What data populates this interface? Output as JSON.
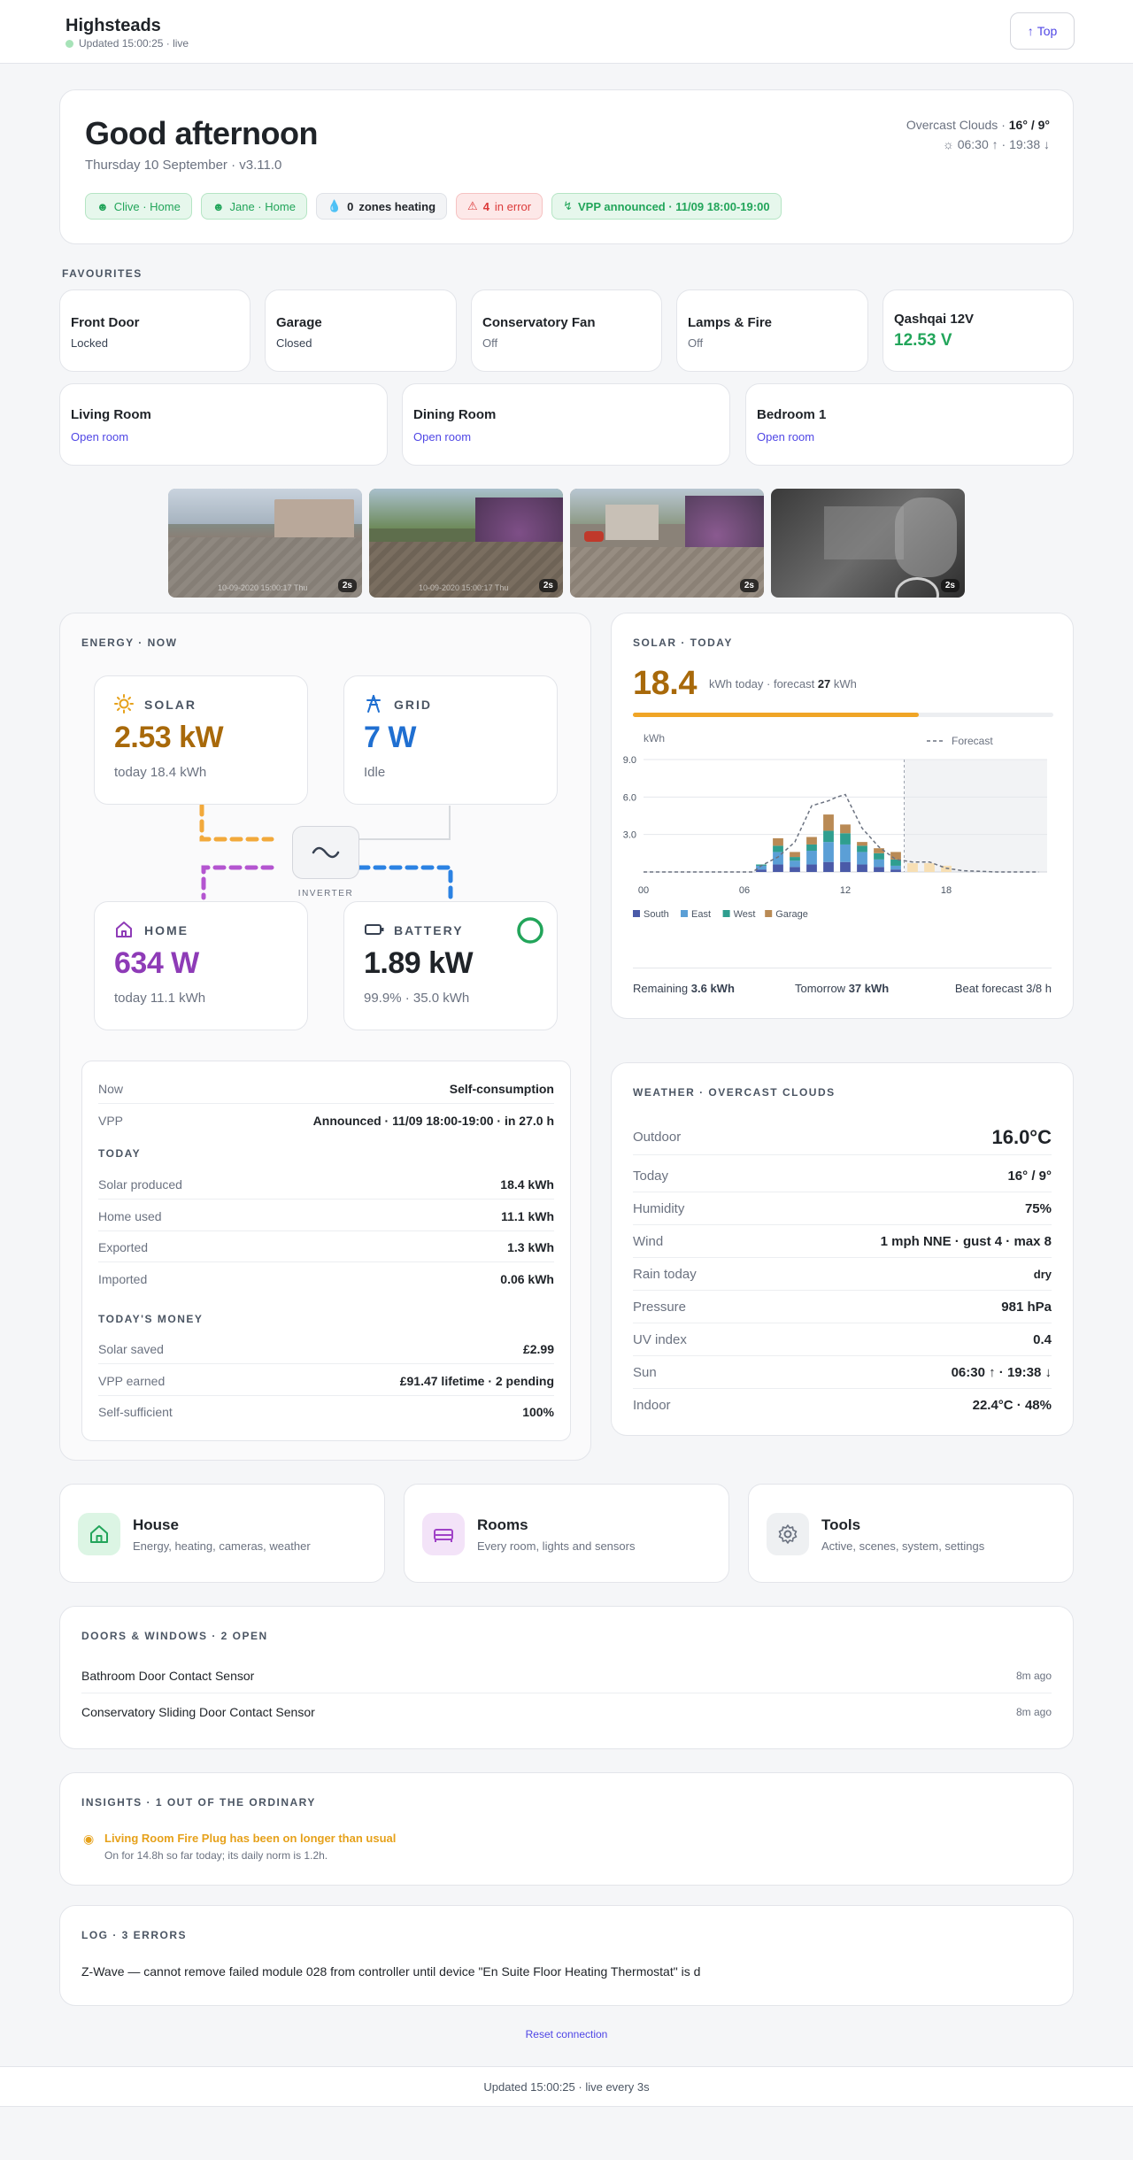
{
  "header": {
    "title": "Highsteads",
    "updated": "Updated 15:00:25 · live",
    "top_button": "Top"
  },
  "hero": {
    "greeting": "Good afternoon",
    "date_version": "Thursday 10 September · v3.11.0",
    "weather_prefix": "Overcast Clouds · ",
    "weather_temp": "16° / 9°",
    "sun_times": "06:30 ↑ · 19:38 ↓",
    "chips": [
      {
        "label": "Clive · Home",
        "tone": "green",
        "icon": "person-icon"
      },
      {
        "label": "Jane · Home",
        "tone": "green",
        "icon": "person-icon"
      },
      {
        "count": "0",
        "label": "zones heating",
        "tone": "grey",
        "icon": "flame-icon"
      },
      {
        "count": "4",
        "label": "in error",
        "tone": "red",
        "icon": "warning-icon"
      },
      {
        "label": "VPP announced · 11/09 18:00-19:00",
        "tone": "green",
        "icon": "bolt-icon"
      }
    ]
  },
  "favourites": {
    "label": "FAVOURITES",
    "items": [
      {
        "title": "Front Door",
        "state": "Locked"
      },
      {
        "title": "Garage",
        "state": "Closed"
      },
      {
        "title": "Conservatory Fan",
        "state": "Off"
      },
      {
        "title": "Lamps & Fire",
        "state": "Off"
      },
      {
        "title": "Qashqai 12V",
        "value": "12.53 V"
      }
    ],
    "rooms": [
      {
        "title": "Living Room",
        "link": "Open room"
      },
      {
        "title": "Dining Room",
        "link": "Open room"
      },
      {
        "title": "Bedroom 1",
        "link": "Open room"
      }
    ]
  },
  "cameras": [
    {
      "age": "2s",
      "stamp": "10-09-2020 15:00:17 Thu"
    },
    {
      "age": "2s",
      "stamp": "10-09-2020 15:00:17 Thu"
    },
    {
      "age": "2s",
      "stamp": ""
    },
    {
      "age": "2s",
      "stamp": ""
    }
  ],
  "energy": {
    "label": "ENERGY · NOW",
    "solar": {
      "label": "SOLAR",
      "value": "2.53 kW",
      "sub": "today 18.4 kWh"
    },
    "grid": {
      "label": "GRID",
      "value": "7 W",
      "sub": "Idle"
    },
    "home": {
      "label": "HOME",
      "value": "634 W",
      "sub": "today 11.1 kWh"
    },
    "battery": {
      "label": "BATTERY",
      "value": "1.89 kW",
      "sub": "99.9% · 35.0 kWh",
      "soc": 0.999
    },
    "inverter_label": "INVERTER",
    "now_rows": [
      {
        "k": "Now",
        "v": "Self-consumption"
      },
      {
        "k": "VPP",
        "v": "Announced · 11/09 18:00-19:00 · in 27.0 h"
      }
    ],
    "today_label": "TODAY",
    "today_rows": [
      {
        "k": "Solar produced",
        "v": "18.4 kWh"
      },
      {
        "k": "Home used",
        "v": "11.1 kWh"
      },
      {
        "k": "Exported",
        "v": "1.3 kWh"
      },
      {
        "k": "Imported",
        "v": "0.06 kWh"
      }
    ],
    "money_label": "TODAY'S MONEY",
    "money_rows": [
      {
        "k": "Solar saved",
        "v": "£2.99"
      },
      {
        "k": "VPP earned",
        "v": "£91.47 lifetime · 2 pending"
      },
      {
        "k": "Self-sufficient",
        "v": "100%"
      }
    ]
  },
  "solar_today": {
    "label": "SOLAR · TODAY",
    "big": "18.4",
    "sub_prefix": "kWh today · forecast ",
    "forecast": "27",
    "sub_suffix": " kWh",
    "progress": 0.68,
    "ylabel": "kWh",
    "forecast_label": "Forecast",
    "footer": [
      {
        "k": "Remaining ",
        "v": "3.6 kWh"
      },
      {
        "k": "Tomorrow ",
        "v": "37 kWh"
      },
      {
        "k": "Beat forecast 3/8 h",
        "v": ""
      }
    ]
  },
  "chart_data": {
    "type": "bar",
    "stacked": true,
    "ylabel": "kWh",
    "ylim": [
      0,
      9.0
    ],
    "yticks": [
      "3.0",
      "6.0",
      "9.0"
    ],
    "xlim": [
      0,
      24
    ],
    "xticks": [
      {
        "x": 0,
        "label": "00"
      },
      {
        "x": 6,
        "label": "06"
      },
      {
        "x": 12,
        "label": "12"
      },
      {
        "x": 18,
        "label": "18"
      }
    ],
    "legend": "bottom-left",
    "categories_hours": [
      7,
      8,
      9,
      10,
      11,
      12,
      13,
      14,
      15
    ],
    "series": [
      {
        "name": "South",
        "color": "#4a5aa8",
        "values": [
          0.2,
          0.6,
          0.4,
          0.6,
          0.8,
          0.8,
          0.6,
          0.4,
          0.2
        ]
      },
      {
        "name": "East",
        "color": "#5b9fd6",
        "values": [
          0.3,
          1.0,
          0.5,
          1.1,
          1.6,
          1.4,
          1.0,
          0.6,
          0.3
        ]
      },
      {
        "name": "West",
        "color": "#2f9e8f",
        "values": [
          0.1,
          0.5,
          0.3,
          0.5,
          0.9,
          0.9,
          0.5,
          0.5,
          0.5
        ]
      },
      {
        "name": "Garage",
        "color": "#b98a55",
        "values": [
          0.0,
          0.6,
          0.4,
          0.6,
          1.3,
          0.7,
          0.3,
          0.4,
          0.6
        ]
      }
    ],
    "forecast_line": {
      "name": "Forecast",
      "x": [
        0,
        6.5,
        7,
        8,
        9,
        10,
        11,
        11.5,
        12,
        13,
        14,
        15,
        16,
        17,
        18,
        19,
        21,
        23.5
      ],
      "y": [
        0,
        0,
        0.5,
        1.2,
        2.4,
        5.3,
        5.7,
        6.0,
        6.2,
        3.5,
        2.0,
        1.0,
        0.8,
        0.8,
        0.3,
        0.1,
        0,
        0
      ]
    },
    "future_bars_hours": [
      16,
      17,
      18
    ],
    "future_bar_values": [
      0.7,
      0.7,
      0.5
    ],
    "now_hour": 15.5
  },
  "weather": {
    "label": "WEATHER · OVERCAST CLOUDS",
    "outdoor_label": "Outdoor",
    "outdoor": "16.0°C",
    "rows": [
      {
        "k": "Today",
        "v": "16° / 9°"
      },
      {
        "k": "Humidity",
        "v": "75%"
      },
      {
        "k": "Wind",
        "v": "1 mph NNE · gust 4 · max 8"
      },
      {
        "k": "Rain today",
        "v": "dry"
      },
      {
        "k": "Pressure",
        "v": "981 hPa"
      },
      {
        "k": "UV index",
        "v": "0.4"
      },
      {
        "k": "Sun",
        "v": "06:30 ↑ · 19:38 ↓"
      },
      {
        "k": "Indoor",
        "v": "22.4°C · 48%"
      }
    ]
  },
  "nav": [
    {
      "title": "House",
      "sub": "Energy, heating, cameras, weather",
      "icon": "house-icon"
    },
    {
      "title": "Rooms",
      "sub": "Every room, lights and sensors",
      "icon": "bed-icon"
    },
    {
      "title": "Tools",
      "sub": "Active, scenes, system, settings",
      "icon": "gear-icon"
    }
  ],
  "doors": {
    "label": "DOORS & WINDOWS · 2 OPEN",
    "items": [
      {
        "name": "Bathroom Door Contact Sensor",
        "age": "8m ago"
      },
      {
        "name": "Conservatory Sliding Door Contact Sensor",
        "age": "8m ago"
      }
    ]
  },
  "insights": {
    "label": "INSIGHTS · 1 OUT OF THE ORDINARY",
    "title": "Living Room Fire Plug has been on longer than usual",
    "detail": "On for 14.8h so far today; its daily norm is 1.2h."
  },
  "log": {
    "label": "LOG · 3 ERRORS",
    "line": "Z-Wave — cannot remove failed module 028 from controller until device \"En Suite Floor Heating Thermostat\" is d"
  },
  "reset_link": "Reset connection",
  "footer": "Updated 15:00:25 · live every 3s",
  "colors": {
    "accent": "#4f46e5",
    "solar": "#a8690a",
    "grid": "#1f6fd1",
    "home": "#8e3bb7",
    "ok": "#22a55a",
    "error": "#dc3a3a"
  }
}
